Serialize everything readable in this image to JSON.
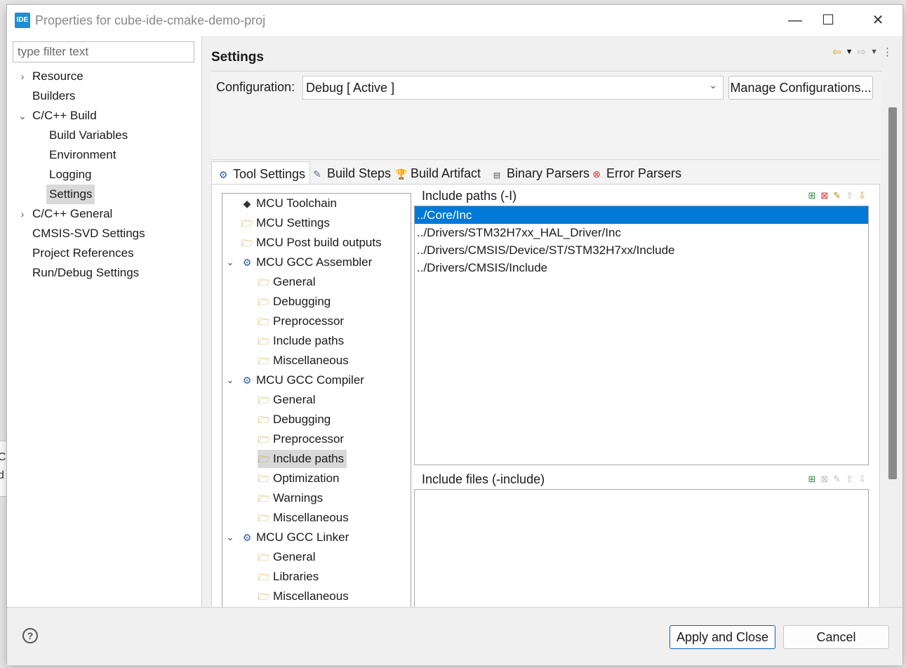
{
  "window": {
    "app_icon": "IDE",
    "title": "Properties for cube-ide-cmake-demo-proj",
    "controls": {
      "minimize": "—",
      "maximize": "☐",
      "close": "✕"
    }
  },
  "sidebar": {
    "filter_placeholder": "type filter text",
    "items": [
      {
        "label": "Resource",
        "expander": "›"
      },
      {
        "label": "Builders"
      },
      {
        "label": "C/C++ Build",
        "expander": "⌄"
      },
      {
        "label": "Build Variables"
      },
      {
        "label": "Environment"
      },
      {
        "label": "Logging"
      },
      {
        "label": "Settings",
        "selected": true
      },
      {
        "label": "C/C++ General",
        "expander": "›"
      },
      {
        "label": "CMSIS-SVD Settings"
      },
      {
        "label": "Project References"
      },
      {
        "label": "Run/Debug Settings"
      }
    ]
  },
  "page": {
    "title": "Settings",
    "configuration_label": "Configuration:",
    "configuration_value": "Debug  [ Active ]",
    "manage_button": "Manage Configurations...",
    "tabs": [
      {
        "label": "Tool Settings",
        "icon": "tool-settings-icon",
        "active": true
      },
      {
        "label": "Build Steps",
        "icon": "build-steps-icon"
      },
      {
        "label": "Build Artifact",
        "icon": "build-artifact-icon"
      },
      {
        "label": "Binary Parsers",
        "icon": "binary-parsers-icon"
      },
      {
        "label": "Error Parsers",
        "icon": "error-parsers-icon"
      }
    ]
  },
  "tool_tree": [
    {
      "label": "MCU Toolchain"
    },
    {
      "label": "MCU Settings"
    },
    {
      "label": "MCU Post build outputs"
    },
    {
      "label": "MCU GCC Assembler"
    },
    {
      "label": "General"
    },
    {
      "label": "Debugging"
    },
    {
      "label": "Preprocessor"
    },
    {
      "label": "Include paths"
    },
    {
      "label": "Miscellaneous"
    },
    {
      "label": "MCU GCC Compiler"
    },
    {
      "label": "General"
    },
    {
      "label": "Debugging"
    },
    {
      "label": "Preprocessor"
    },
    {
      "label": "Include paths",
      "selected": true
    },
    {
      "label": "Optimization"
    },
    {
      "label": "Warnings"
    },
    {
      "label": "Miscellaneous"
    },
    {
      "label": "MCU GCC Linker"
    },
    {
      "label": "General"
    },
    {
      "label": "Libraries"
    },
    {
      "label": "Miscellaneous"
    }
  ],
  "include_paths": {
    "title": "Include paths (-I)",
    "items": [
      "../Core/Inc",
      "../Drivers/STM32H7xx_HAL_Driver/Inc",
      "../Drivers/CMSIS/Device/ST/STM32H7xx/Include",
      "../Drivers/CMSIS/Include"
    ]
  },
  "include_files": {
    "title": "Include files (-include)",
    "items": []
  },
  "footer": {
    "help": "?",
    "apply_button": "Apply and Close",
    "cancel_button": "Cancel"
  },
  "background_fragments": [
    "Co",
    "d"
  ],
  "colors": {
    "selection": "#0078d7",
    "app_icon": "#1e8fd6"
  }
}
